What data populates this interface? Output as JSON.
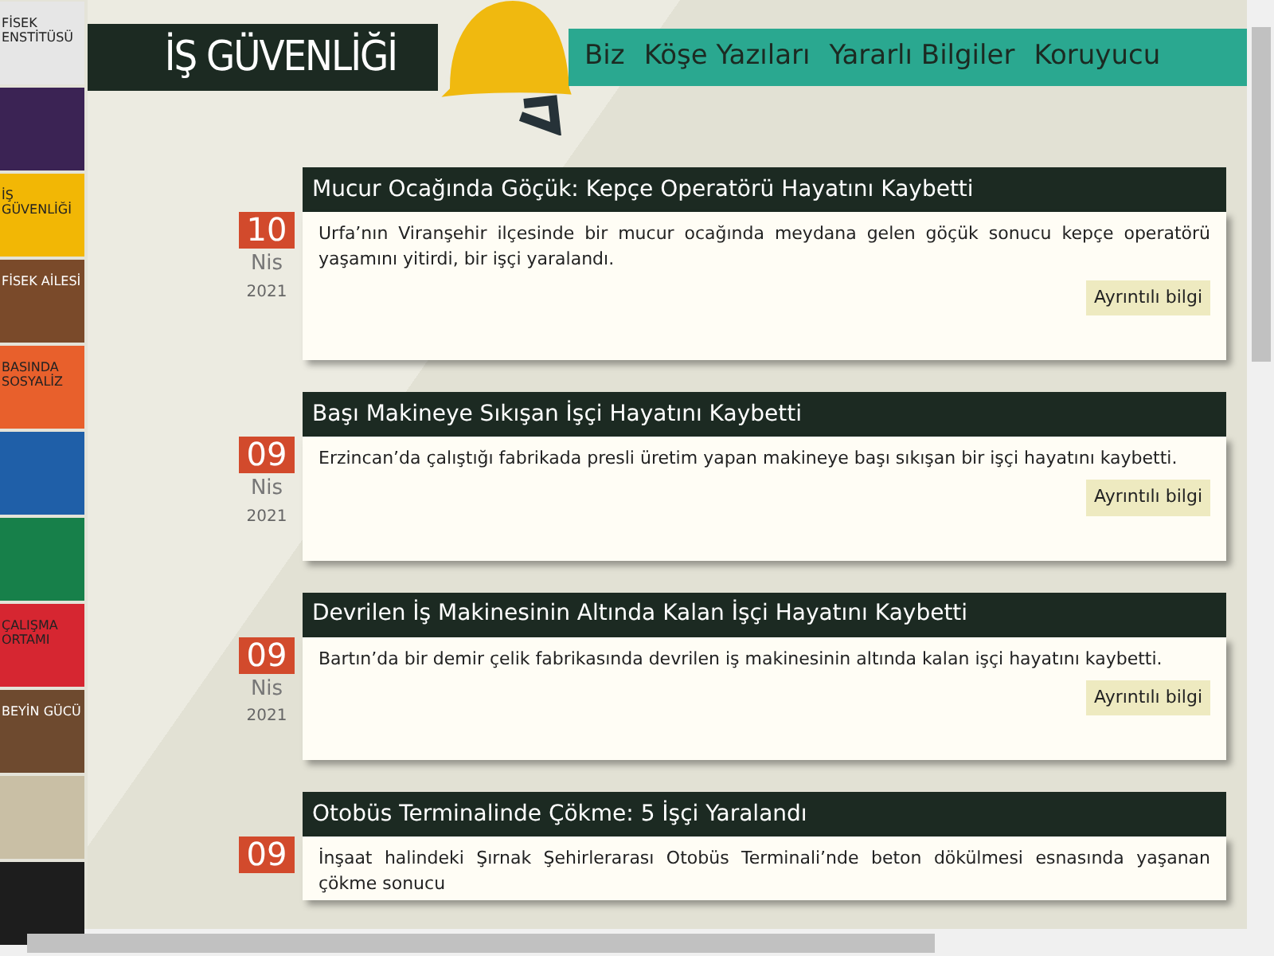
{
  "sidebar": {
    "tiles": [
      {
        "alt": "FİSEK ENSTİTÜSÜ",
        "color": "#e6e6e6"
      },
      {
        "color": "#3b2354"
      },
      {
        "alt": "İŞ GÜVENLİĞİ",
        "color": "#f2b705"
      },
      {
        "alt": "FİSEK AİLESİ",
        "color": "#7a4a2a"
      },
      {
        "alt": "BASINDA SOSYALİZ",
        "color": "#e8602c"
      },
      {
        "color": "#1f5fa8"
      },
      {
        "color": "#17804a"
      },
      {
        "alt": "ÇALIŞMA ORTAMI",
        "color": "#d62631"
      },
      {
        "alt": "BEYİN GÜCÜ",
        "color": "#6e4a2f"
      },
      {
        "color": "#c9bfa5"
      },
      {
        "color": "#1d1d1d"
      }
    ]
  },
  "header": {
    "title": "İŞ GÜVENLİĞİ",
    "nav": [
      "Biz",
      "Köşe Yazıları",
      "Yararlı Bilgiler",
      "Koruyucu"
    ]
  },
  "posts": [
    {
      "title": "Mucur Ocağında Göçük: Kepçe Operatörü Hayatını Kaybetti",
      "day": "10",
      "month": "Nis",
      "year": "2021",
      "text": "Urfa’nın Viranşehir ilçesinde bir mucur ocağında meydana gelen göçük sonucu kepçe operatörü yaşamını yitirdi, bir işçi yaralandı.",
      "button": "Ayrıntılı bilgi"
    },
    {
      "title": "Başı Makineye Sıkışan İşçi Hayatını Kaybetti",
      "day": "09",
      "month": "Nis",
      "year": "2021",
      "text": "Erzincan’da çalıştığı fabrikada presli üretim yapan makineye başı sıkışan bir işçi hayatını kaybetti.",
      "button": "Ayrıntılı bilgi"
    },
    {
      "title": "Devrilen İş Makinesinin Altında Kalan İşçi Hayatını Kaybetti",
      "day": "09",
      "month": "Nis",
      "year": "2021",
      "text": "Bartın’da bir demir çelik fabrikasında devrilen iş makinesinin altında kalan işçi hayatını kaybetti.",
      "button": "Ayrıntılı bilgi"
    },
    {
      "title": "Otobüs Terminalinde Çökme: 5 İşçi Yaralandı",
      "day": "09",
      "text": "İnşaat halindeki Şırnak Şehirlerarası Otobüs Terminali’nde beton dökülmesi esnasında yaşanan çökme sonucu"
    }
  ]
}
